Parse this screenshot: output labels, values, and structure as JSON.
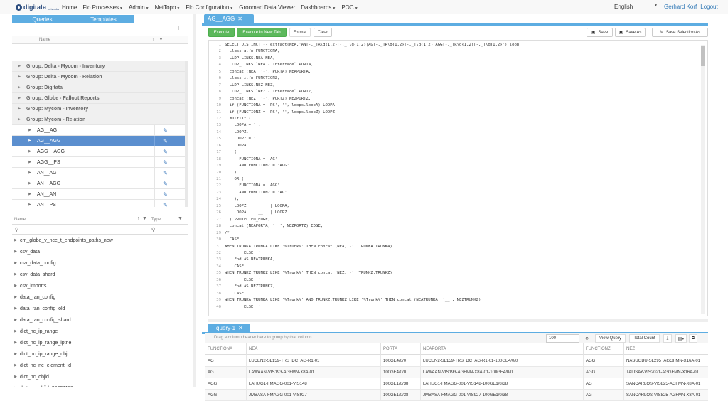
{
  "nav": {
    "logo_text": "digitata",
    "logo_sub": "networks",
    "items": [
      {
        "label": "Home",
        "caret": false
      },
      {
        "label": "Flo Processes",
        "caret": true
      },
      {
        "label": "Admin",
        "caret": true
      },
      {
        "label": "NetTopo",
        "caret": true
      },
      {
        "label": "Flo Configuration",
        "caret": true
      },
      {
        "label": "Groomed Data Viewer",
        "caret": false
      },
      {
        "label": "Dashboards",
        "caret": true
      },
      {
        "label": "POC",
        "caret": true
      }
    ],
    "language": "English",
    "user": "Gerhard Korf",
    "logout": "Logout"
  },
  "left": {
    "tabs": [
      "Queries",
      "Templates"
    ],
    "add_label": "+",
    "tree_header": "Name",
    "tree_rows": [
      {
        "type": "group",
        "label": "Group: Delta - Mycom - Inventory"
      },
      {
        "type": "group",
        "label": "Group: Delta - Mycom - Relation"
      },
      {
        "type": "group",
        "label": "Group: Digitata"
      },
      {
        "type": "group",
        "label": "Group: Globe - Fallout Reports"
      },
      {
        "type": "group",
        "label": "Group: Mycom - Inventory"
      },
      {
        "type": "group",
        "label": "Group: Mycom - Relation"
      },
      {
        "type": "item",
        "label": "AG__AG"
      },
      {
        "type": "item",
        "label": "AG__AGG",
        "selected": true
      },
      {
        "type": "item",
        "label": "AGG__AGG"
      },
      {
        "type": "item",
        "label": "AGG__PS"
      },
      {
        "type": "item",
        "label": "AN__AG"
      },
      {
        "type": "item",
        "label": "AN__AGG"
      },
      {
        "type": "item",
        "label": "AN__AN"
      },
      {
        "type": "item",
        "label": "AN__PS"
      }
    ],
    "table_header_name": "Name",
    "table_header_type": "Type",
    "filter_name_placeholder": "",
    "filter_type_placeholder": "",
    "tables": [
      "cm_globe_v_nce_t_endpoints_paths_new",
      "csv_data",
      "csv_data_config",
      "csv_data_shard",
      "csv_imports",
      "data_ran_config",
      "data_ran_config_old",
      "data_ran_config_shard",
      "dict_nc_ip_range",
      "dict_nc_ip_range_iptrie",
      "dict_nc_ip_range_obj",
      "dict_nc_ne_element_id",
      "dict_nc_objid",
      "dict_nc_objid_20221118",
      "dict_nc_objid_new"
    ]
  },
  "editor": {
    "tab_label": "AG__AGG",
    "close": "✕",
    "buttons": {
      "execute": "Execute",
      "execute_new_tab": "Execute In New Tab",
      "format": "Format",
      "clear": "Clear",
      "save": "Save",
      "save_as": "Save As",
      "save_selection": "Save Selection As"
    },
    "lines": [
      "SELECT DISTINCT -- extract(NEA,'AN[-,_]R\\d{1,2}[-,_]\\d{1,2}|AG[-,_]R\\d{1,2}[-,_]\\d{1,2}|AGG[-,_]R\\d{1,2}[-,_]\\d{1,2}') loop",
      "  class_a.fn FUNCTIONA,",
      "  LLDP_LINKS.NEA NEA,",
      "  LLDP_LINKS.`NEA - Interface` PORTA,",
      "  concat (NEA, '-', PORTA) NEAPORTA,",
      "  class_z.fn FUNCTIONZ,",
      "  LLDP_LINKS.NEZ NEZ,",
      "  LLDP_LINKS.`NEZ - Interface` PORTZ,",
      "  concat (NEZ, '-', PORTZ) NEZPORTZ,",
      "  if (FUNCTIONA = 'PS', '', loops.loopA) LOOPA,",
      "  if (FUNCTIONZ = 'PS', '', loops.loopZ) LOOPZ,",
      "  multiIf (",
      "    LOOPA = '',",
      "    LOOPZ,",
      "    LOOPZ = '',",
      "    LOOPA,",
      "    (",
      "      FUNCTIONA = 'AG'",
      "      AND FUNCTIONZ = 'AGG'",
      "    )",
      "    OR (",
      "      FUNCTIONA = 'AGG'",
      "      AND FUNCTIONZ = 'AG'",
      "    ),",
      "    LOOPZ || '__' || LOOPA,",
      "    LOOPA || '__' || LOOPZ",
      "  ) PROTECTED_EDGE,",
      "  concat (NEAPORTA, '__', NEZPORTZ) EDGE,",
      "/*",
      "  CASE",
      "WHEN TRUNKA.TRUNKA LIKE '%Trunk%' THEN concat (NEA,'-', TRUNKA.TRUNKA)",
      "        ELSE ''",
      "    End AS NEATRUNKA,",
      "    CASE",
      "WHEN TRUNKZ.TRUNKZ LIKE '%Trunk%' THEN concat (NEZ,'-', TRUNKZ.TRUNKZ)",
      "        ELSE ''",
      "    End AS NEZTRUNKZ,",
      "    CASE",
      "WHEN TRUNKA.TRUNKA LIKE '%Trunk%' AND TRUNKZ.TRUNKZ LIKE '%Trunk%' THEN concat (NEATRUNKA, '__', NEZTRUNKZ)",
      "        ELSE ''"
    ]
  },
  "results": {
    "tab_label": "query-1",
    "close": "✕",
    "group_hint": "Drag a column header here to group by that column",
    "page_size": "100",
    "view_query": "View Query",
    "total_count": "Total Count",
    "columns": [
      "FUNCTIONA",
      "NEA",
      "PORTA",
      "NEAPORTA",
      "FUNCTIONZ",
      "NEZ"
    ],
    "rows": [
      [
        "AG",
        "LUCEN2-SL159-TRS_DC_AG-R1-01",
        "100GE4/0/0",
        "LUCEN2-SL159-TRS_DC_AG-R1-01-100GE4/0/0",
        "AGG",
        "NASUGBU-SL295_AGGFMN-X16A-01"
      ],
      [
        "AG",
        "LAWAAN-VIS193-AGFMN-X8A-01",
        "100GE4/0/0",
        "LAWAAN-VIS193-AGFMN-X8A-01-100GE4/0/0",
        "AGG",
        "TALISAY-VIS2021-AGGFMN-X16A-01"
      ],
      [
        "AGG",
        "LAHUG1-FMAGG-001-VIS148",
        "100GE1/0/38",
        "LAHUG1-FMAGG-001-VIS148-100GE1/0/38",
        "AG",
        "SANCARLOS-VIS825-AGFMN-X8A-01"
      ],
      [
        "AGG",
        "JMBASA-FMAGG-001-VIS927",
        "100GE1/0/38",
        "JMBASA-FMAGG-001-VIS927-100GE1/0/38",
        "AG",
        "SANCARLOS-VIS825-AGFMN-X8A-01"
      ]
    ]
  }
}
